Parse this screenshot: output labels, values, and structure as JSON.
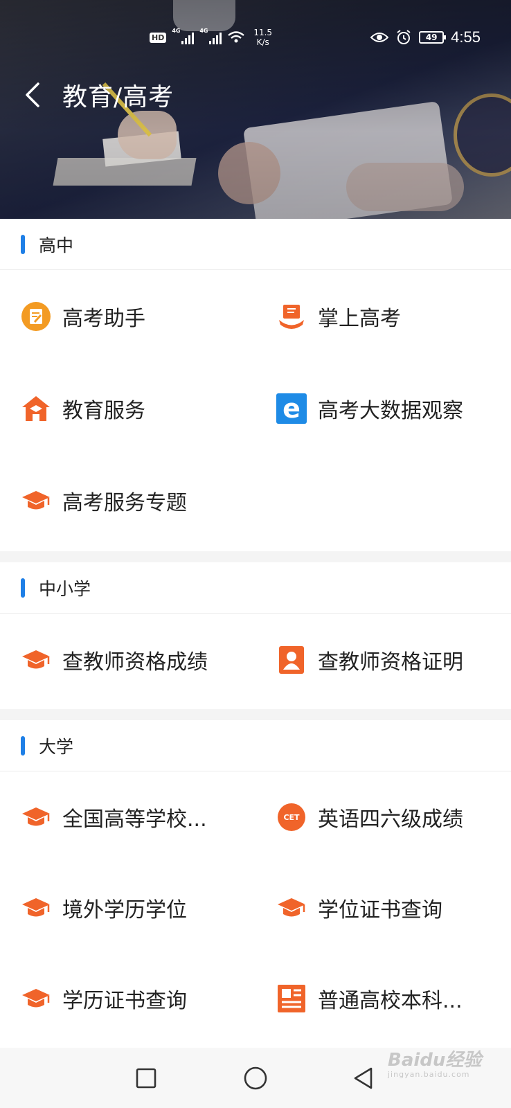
{
  "status_bar": {
    "hd_label": "HD",
    "net1": "4G",
    "net2": "4G",
    "speed_value": "11.5",
    "speed_unit": "K/s",
    "battery": "49",
    "time": "4:55"
  },
  "header": {
    "title": "教育/高考"
  },
  "sections": [
    {
      "title": "高中",
      "items": [
        {
          "label": "高考助手",
          "icon": "note-icon"
        },
        {
          "label": "掌上高考",
          "icon": "book-hand-icon"
        },
        {
          "label": "教育服务",
          "icon": "school-house-icon"
        },
        {
          "label": "高考大数据观察",
          "icon": "e-icon"
        },
        {
          "label": "高考服务专题",
          "icon": "graduation-cap-icon"
        }
      ]
    },
    {
      "title": "中小学",
      "items": [
        {
          "label": "查教师资格成绩",
          "icon": "graduation-cap-icon"
        },
        {
          "label": "查教师资格证明",
          "icon": "person-badge-icon"
        }
      ]
    },
    {
      "title": "大学",
      "items": [
        {
          "label": "全国高等学校...",
          "icon": "graduation-cap-icon"
        },
        {
          "label": "英语四六级成绩",
          "icon": "cet-icon",
          "icon_text": "CET"
        },
        {
          "label": "境外学历学位",
          "icon": "graduation-cap-icon"
        },
        {
          "label": "学位证书查询",
          "icon": "graduation-cap-icon"
        },
        {
          "label": "学历证书查询",
          "icon": "graduation-cap-icon"
        },
        {
          "label": "普通高校本科...",
          "icon": "document-list-icon"
        }
      ]
    }
  ],
  "watermark": {
    "brand": "Baidu经验",
    "url": "jingyan.baidu.com"
  },
  "colors": {
    "accent_blue": "#1e7fe6",
    "icon_orange": "#f0642a",
    "icon_amber": "#f39b23"
  }
}
